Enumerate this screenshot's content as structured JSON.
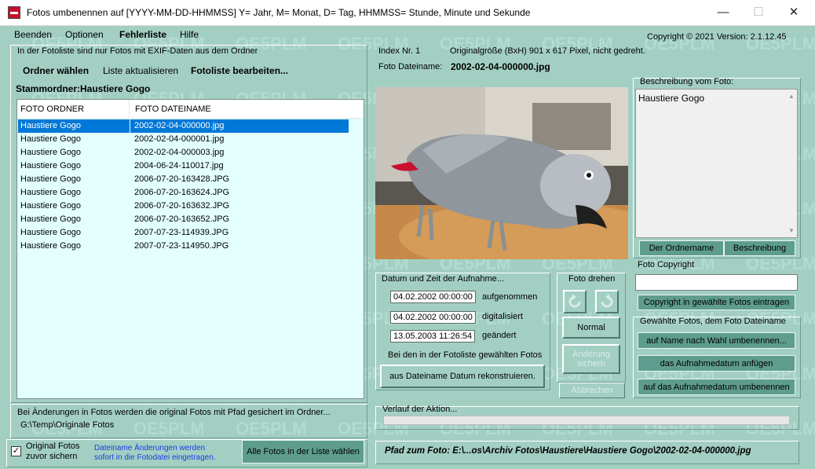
{
  "window": {
    "title": "Fotos umbenennen auf [YYYY-MM-DD-HHMMSS] Y= Jahr, M= Monat, D= Tag, HHMMSS= Stunde, Minute und Sekunde",
    "minimize": "—",
    "maximize": "☐",
    "close": "✕"
  },
  "menu": {
    "beenden": "Beenden",
    "optionen": "Optionen",
    "fehlerliste": "Fehlerliste",
    "hilfe": "Hilfe"
  },
  "copyright_header": "Copyright ©  2021 Version: 2.1.12.45",
  "left": {
    "info": "In der Fotoliste sind nur Fotos mit EXIF-Daten aus dem Ordner",
    "ordner_waehlen": "Ordner wählen",
    "liste_aktualisieren": "Liste aktualisieren",
    "fotoliste_bearbeiten": "Fotoliste bearbeiten...",
    "stammordner_label": "Stammordner:",
    "stammordner_value": "Haustiere Gogo",
    "columns": [
      "FOTO ORDNER",
      "FOTO DATEINAME"
    ],
    "rows": [
      {
        "folder": "Haustiere Gogo",
        "file": "2002-02-04-000000.jpg"
      },
      {
        "folder": "Haustiere Gogo",
        "file": "2002-02-04-000001.jpg"
      },
      {
        "folder": "Haustiere Gogo",
        "file": "2002-02-04-000003.jpg"
      },
      {
        "folder": "Haustiere Gogo",
        "file": "2004-06-24-110017.jpg"
      },
      {
        "folder": "Haustiere Gogo",
        "file": "2006-07-20-163428.JPG"
      },
      {
        "folder": "Haustiere Gogo",
        "file": "2006-07-20-163624.JPG"
      },
      {
        "folder": "Haustiere Gogo",
        "file": "2006-07-20-163632.JPG"
      },
      {
        "folder": "Haustiere Gogo",
        "file": "2006-07-20-163652.JPG"
      },
      {
        "folder": "Haustiere Gogo",
        "file": "2007-07-23-114939.JPG"
      },
      {
        "folder": "Haustiere Gogo",
        "file": "2007-07-23-114950.JPG"
      }
    ],
    "backup_info": "Bei Änderungen in Fotos werden die original Fotos mit Pfad gesichert im Ordner...",
    "backup_path": "G:\\Temp\\Originale Fotos",
    "original_fotos": "Original Fotos",
    "zuvor_sichern": "zuvor sichern",
    "checkbox_mark": "✓",
    "dateiname_info_1": "Dateiname Änderungen werden",
    "dateiname_info_2": "sofort in die Fotodatei eingetragen.",
    "alle_fotos": "Alle Fotos in der Liste wählen"
  },
  "center": {
    "index_label": "Index Nr. 1",
    "originalgroesse": "Originalgröße (BxH) 901 x 617 Pixel, nicht gedreht.",
    "dateiname_label": "Foto Dateiname:",
    "dateiname_value": "2002-02-04-000000.jpg",
    "datum_title": "Datum und Zeit der Aufnahme...",
    "aufgenommen_value": "04.02.2002 00:00:00",
    "aufgenommen_label": "aufgenommen",
    "digitalisiert_value": "04.02.2002 00:00:00",
    "digitalisiert_label": "digitalisiert",
    "geaendert_value": "13.05.2003 11:26:54",
    "geaendert_label": "geändert",
    "bei_den": "Bei den in der Fotoliste gewählten Fotos",
    "rekonstruieren": "aus Dateiname Datum rekonstruieren.",
    "foto_drehen": "Foto drehen",
    "normal": "Normal",
    "aenderung_sichern": "Änderung sichern",
    "abbrechen": "Abbrechen",
    "verlauf": "Verlauf der Aktion...",
    "pfad": "Pfad zum Foto: E:\\...os\\Archiv Fotos\\Haustiere\\Haustiere Gogo\\2002-02-04-000000.jpg",
    "progress": 0
  },
  "right": {
    "beschreibung_label": "Beschreibung vom Foto:",
    "beschreibung_value": "Haustiere Gogo",
    "der_ordnername": "Der Ordnername",
    "beschreibung_btn": "Beschreibung",
    "foto_copyright": "Foto Copyright",
    "copyright_eintragen": "Copyright in gewählte Fotos eintragen",
    "gewaehlte_fotos": "Gewählte Fotos, dem Foto Dateiname",
    "name_nach_wahl": "auf Name nach Wahl umbenennen...",
    "datum_anfuegen": "das Aufnahmedatum anfügen",
    "datum_umbenennen": "auf das Aufnahmedatum umbenennen"
  },
  "watermark_text": "OE5PLM",
  "colors": {
    "background": "#a3cfc3",
    "button_dark": "#5e9d8d",
    "list_bg": "#e2fffe",
    "selection": "#0078d7",
    "path_color": "#000"
  }
}
